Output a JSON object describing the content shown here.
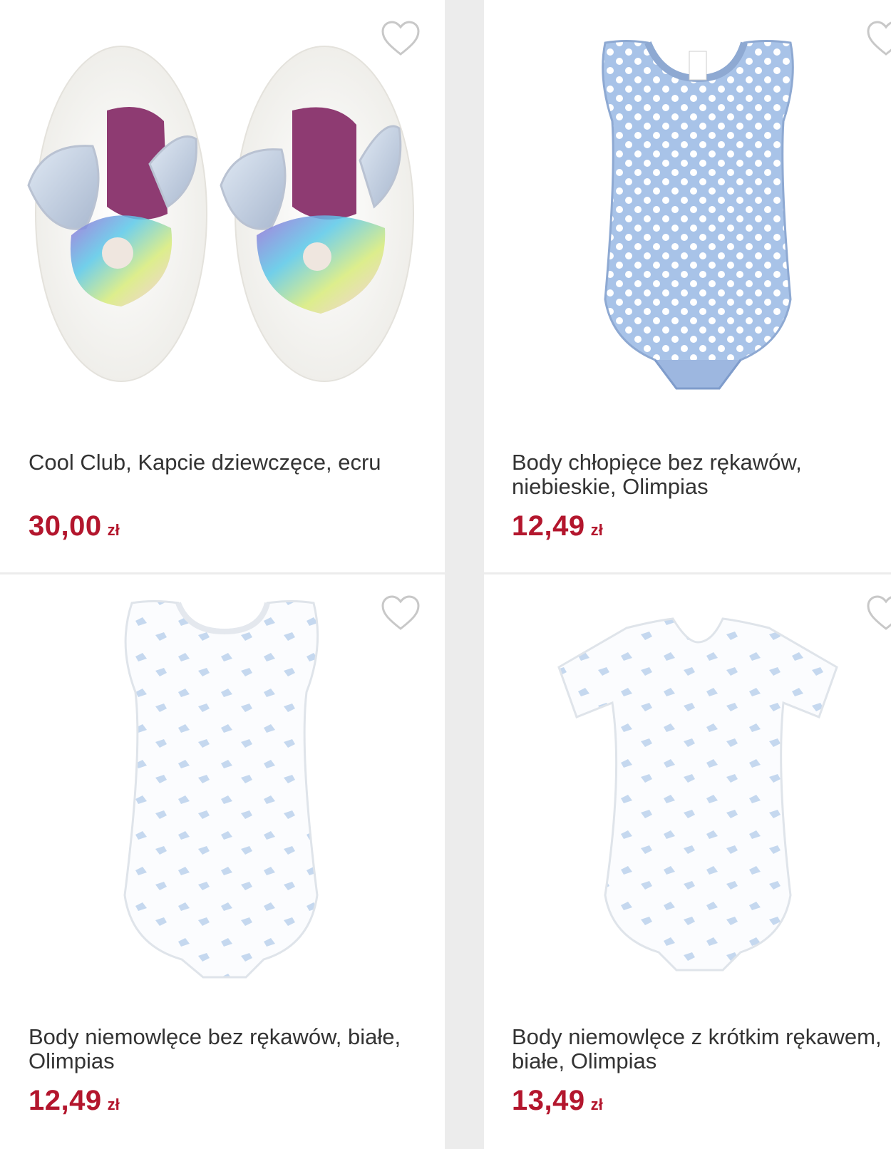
{
  "products": [
    {
      "title": "Cool Club, Kapcie dziewczęce, ecru",
      "price": "30,00",
      "currency": "zł",
      "favorite_icon": "heart-outline-icon"
    },
    {
      "title": "Body chłopięce bez rękawów, niebieskie, Olimpias",
      "price": "12,49",
      "currency": "zł",
      "favorite_icon": "heart-outline-icon"
    },
    {
      "title": "Body niemowlęce bez rękawów, białe, Olimpias",
      "price": "12,49",
      "currency": "zł",
      "favorite_icon": "heart-outline-icon"
    },
    {
      "title": "Body niemowlęce z krótkim rękawem, białe, Olimpias",
      "price": "13,49",
      "currency": "zł",
      "favorite_icon": "heart-outline-icon"
    }
  ],
  "colors": {
    "price": "#b3162d",
    "title": "#333333",
    "heart": "#c8c8c8",
    "background": "#ececec"
  }
}
